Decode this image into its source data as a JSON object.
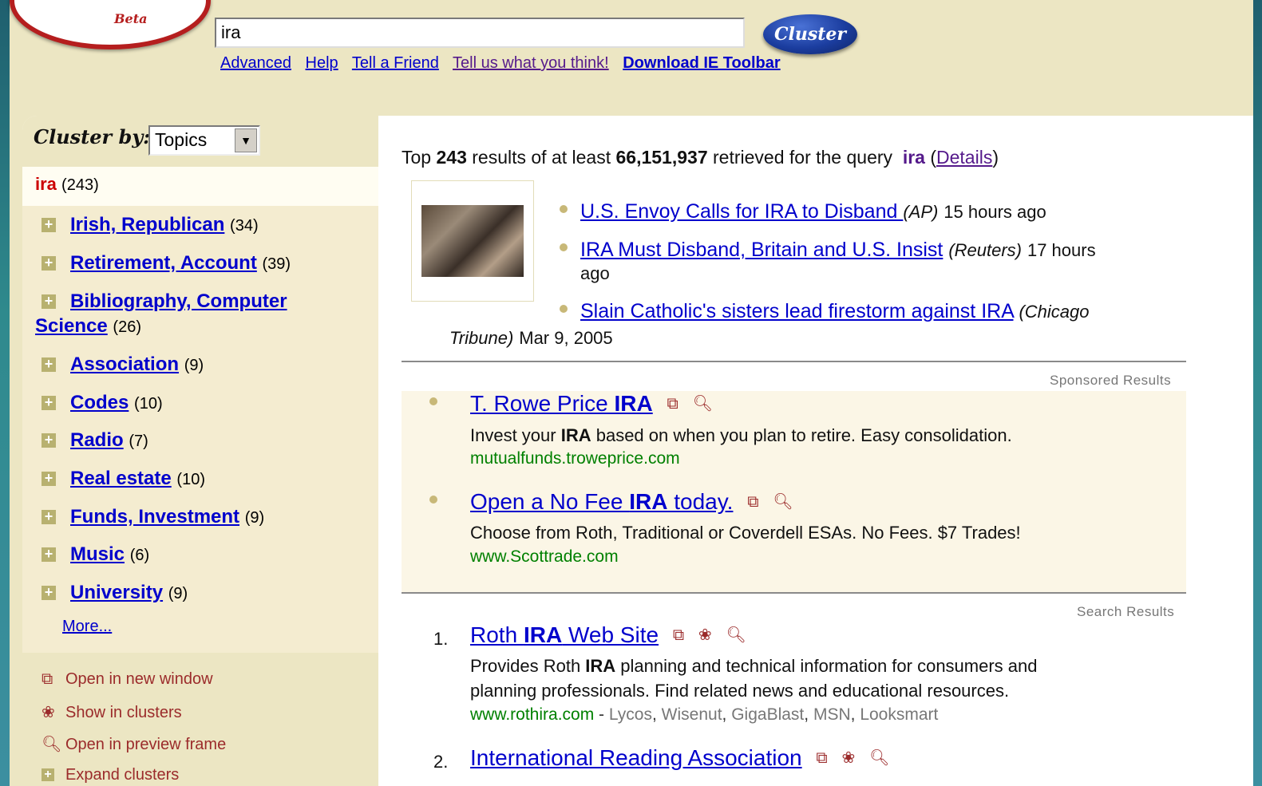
{
  "header": {
    "logo_beta": "Beta",
    "search_value": "ira",
    "cluster_button": "Cluster",
    "links": [
      "Advanced",
      "Help",
      "Tell a Friend",
      "Tell us what you think!",
      "Download IE Toolbar"
    ]
  },
  "sidebar": {
    "cluster_by_label": "Cluster by:",
    "cluster_by_value": "Topics",
    "root_query": "ira",
    "root_count": "(243)",
    "clusters": [
      {
        "label": "Irish, Republican",
        "count": "(34)"
      },
      {
        "label": "Retirement, Account",
        "count": "(39)"
      },
      {
        "label": "Bibliography, Computer",
        "label2": "Science",
        "count": "(26)"
      },
      {
        "label": "Association",
        "count": "(9)"
      },
      {
        "label": "Codes",
        "count": "(10)"
      },
      {
        "label": "Radio",
        "count": "(7)"
      },
      {
        "label": "Real estate",
        "count": "(10)"
      },
      {
        "label": "Funds, Investment",
        "count": "(9)"
      },
      {
        "label": "Music",
        "count": "(6)"
      },
      {
        "label": "University",
        "count": "(9)"
      }
    ],
    "more": "More...",
    "legend": [
      "Open in new window",
      "Show in clusters",
      "Open in preview frame",
      "Expand clusters"
    ]
  },
  "main": {
    "summary": {
      "pre": "Top",
      "top": "243",
      "mid": "results of at least",
      "total": "66,151,937",
      "post": "retrieved for the query",
      "query": "ira",
      "details": "Details"
    },
    "news": [
      {
        "title": "U.S. Envoy Calls for IRA to Disband ",
        "source": "(AP)",
        "time": "15 hours ago"
      },
      {
        "title": "IRA Must Disband, Britain and U.S. Insist",
        "source": "(Reuters)",
        "time": "17 hours",
        "time2": "ago"
      },
      {
        "title": "Slain Catholic's sisters lead firestorm against IRA",
        "source": "(Chicago",
        "source2": "Tribune)",
        "time": "Mar 9, 2005"
      }
    ],
    "sponsored_label": "Sponsored Results",
    "sponsored": [
      {
        "t1": "T. Rowe Price ",
        "t2": "IRA",
        "d1": "Invest your ",
        "d2": "IRA",
        "d3": " based on when you plan to retire. Easy consolidation.",
        "url": "mutualfunds.troweprice.com"
      },
      {
        "t1": "Open a No Fee ",
        "t2": "IRA",
        "t3": " today.",
        "d1": "Choose from Roth, Traditional or Coverdell ESAs. No Fees. $7 Trades!",
        "url": "www.Scottrade.com"
      }
    ],
    "search_label": "Search Results",
    "results": [
      {
        "num": "1.",
        "t1": "Roth ",
        "t2": "IRA",
        "t3": " Web Site",
        "d1": "Provides Roth ",
        "d2": "IRA",
        "d3": " planning and technical information for consumers and",
        "d4": "planning professionals. Find related news and educational resources.",
        "url": "www.rothira.com",
        "engines": [
          "Lycos",
          "Wisenut",
          "GigaBlast",
          "MSN",
          "Looksmart"
        ]
      },
      {
        "num": "2.",
        "t1": "International Reading Association"
      }
    ]
  }
}
